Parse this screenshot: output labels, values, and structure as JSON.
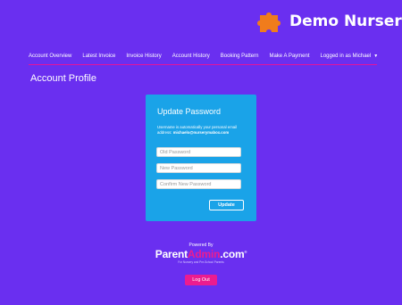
{
  "brand": {
    "name": "Demo Nursery",
    "logo_icon": "puzzle-piece-icon",
    "logo_color": "#f07c1c"
  },
  "nav": {
    "items": [
      {
        "label": "Account Overview"
      },
      {
        "label": "Latest Invoice"
      },
      {
        "label": "Invoice History"
      },
      {
        "label": "Account History"
      },
      {
        "label": "Booking Pattern"
      },
      {
        "label": "Make A Payment"
      }
    ],
    "user_menu": {
      "label": "Logged in as Michael",
      "icon": "chevron-down-icon"
    }
  },
  "page": {
    "title": "Account Profile"
  },
  "password_form": {
    "title": "Update Password",
    "note_text": "Username is automatically your personal email address:",
    "note_email": "michaelo@nurserymabox.com",
    "old_password": {
      "placeholder": "Old Password",
      "value": ""
    },
    "new_password": {
      "placeholder": "New Password",
      "value": ""
    },
    "confirm_password": {
      "placeholder": "Confirm New Password",
      "value": ""
    },
    "submit_label": "Update"
  },
  "footer": {
    "powered_by": "Powered By",
    "logo_parts": {
      "part1": "Parent",
      "part2": "Admin",
      "part3": ".com",
      "trademark": "®"
    },
    "logo_tagline": "For Nursery and Pre-School Parents",
    "logout_label": "Log Out"
  },
  "colors": {
    "background": "#6a2ff0",
    "card": "#1aa3e8",
    "accent": "#e5149a",
    "logout_button": "#ec1c8f"
  }
}
